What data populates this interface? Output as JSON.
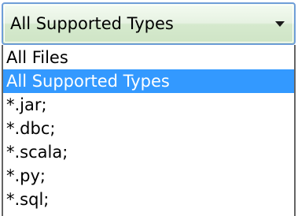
{
  "combo": {
    "selected_value": "All Supported Types",
    "arrow_icon": "chevron-down-icon"
  },
  "dropdown": {
    "options": [
      {
        "label": "All Files",
        "selected": false
      },
      {
        "label": "All Supported Types",
        "selected": true
      },
      {
        "label": "*.jar;",
        "selected": false
      },
      {
        "label": "*.dbc;",
        "selected": false
      },
      {
        "label": "*.scala;",
        "selected": false
      },
      {
        "label": "*.py;",
        "selected": false
      },
      {
        "label": "*.sql;",
        "selected": false
      }
    ]
  },
  "colors": {
    "highlight": "#3399ff",
    "border": "#6f9ed8"
  }
}
